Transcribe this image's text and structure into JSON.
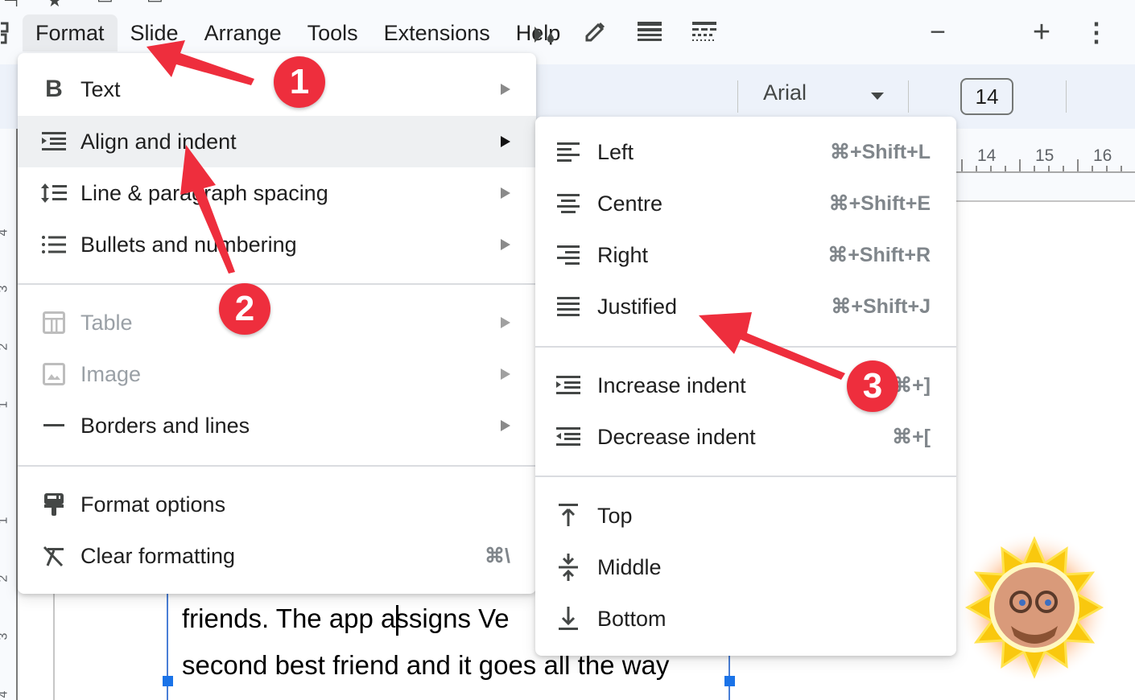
{
  "menubar": {
    "items": [
      {
        "label": "t",
        "partial": true
      },
      {
        "label": "Format",
        "active": true
      },
      {
        "label": "Slide"
      },
      {
        "label": "Arrange"
      },
      {
        "label": "Tools"
      },
      {
        "label": "Extensions"
      },
      {
        "label": "Help"
      }
    ]
  },
  "toolbar": {
    "icons": [
      "fill-color-icon",
      "border-color-icon",
      "border-weight-icon",
      "border-dash-icon"
    ],
    "font_name": "Arial",
    "font_size": "14",
    "decrease_size_label": "−",
    "increase_size_label": "+",
    "more_label": "⋮"
  },
  "ruler": {
    "horizontal_labels": [
      "14",
      "15",
      "16"
    ],
    "vertical_labels": [
      "4",
      "3",
      "2",
      "1",
      "1",
      "2",
      "3",
      "4"
    ]
  },
  "format_menu": {
    "items": [
      {
        "label": "Text",
        "icon": "bold-icon",
        "submenu": true
      },
      {
        "label": "Align and indent",
        "icon": "align-indent-icon",
        "submenu": true,
        "highlighted": true
      },
      {
        "label": "Line & paragraph spacing",
        "icon": "line-spacing-icon",
        "submenu": true
      },
      {
        "label": "Bullets and numbering",
        "icon": "bulleted-list-icon",
        "submenu": true
      },
      {
        "label": "Table",
        "icon": "table-icon",
        "submenu": true,
        "disabled": true
      },
      {
        "label": "Image",
        "icon": "image-icon",
        "submenu": true,
        "disabled": true
      },
      {
        "label": "Borders and lines",
        "icon": "horizontal-line-icon",
        "submenu": true
      },
      {
        "label": "Format options",
        "icon": "paint-roller-icon"
      },
      {
        "label": "Clear formatting",
        "icon": "clear-format-icon",
        "shortcut": "⌘\\"
      }
    ]
  },
  "align_menu": {
    "items": [
      {
        "label": "Left",
        "icon": "align-left-icon",
        "shortcut": "⌘+Shift+L"
      },
      {
        "label": "Centre",
        "icon": "align-center-icon",
        "shortcut": "⌘+Shift+E"
      },
      {
        "label": "Right",
        "icon": "align-right-icon",
        "shortcut": "⌘+Shift+R"
      },
      {
        "label": "Justified",
        "icon": "align-justify-icon",
        "shortcut": "⌘+Shift+J"
      },
      {
        "label": "Increase indent",
        "icon": "indent-increase-icon",
        "shortcut": "⌘+]"
      },
      {
        "label": "Decrease indent",
        "icon": "indent-decrease-icon",
        "shortcut": "⌘+["
      },
      {
        "label": "Top",
        "icon": "vertical-align-top-icon"
      },
      {
        "label": "Middle",
        "icon": "vertical-align-middle-icon"
      },
      {
        "label": "Bottom",
        "icon": "vertical-align-bottom-icon"
      }
    ]
  },
  "slide": {
    "lines": [
      "friends. The app assigns Ve",
      "second best friend and it goes all the way"
    ]
  },
  "annotations": {
    "badges": [
      "1",
      "2",
      "3"
    ],
    "color": "#ee2e3d"
  }
}
